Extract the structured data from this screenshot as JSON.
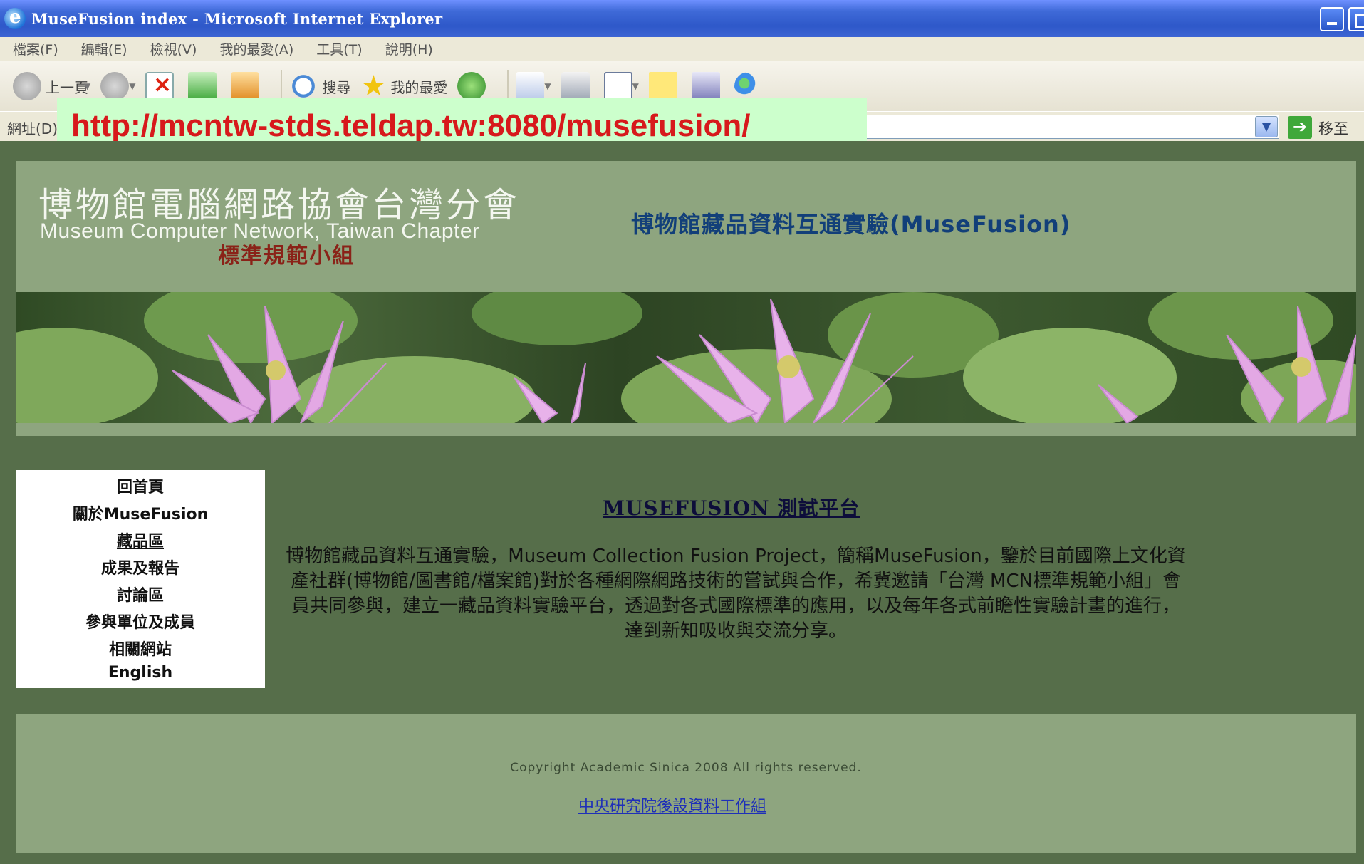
{
  "browser": {
    "window_title": "MuseFusion index - Microsoft Internet Explorer",
    "menu": [
      "檔案(F)",
      "編輯(E)",
      "檢視(V)",
      "我的最愛(A)",
      "工具(T)",
      "說明(H)"
    ],
    "toolbar": {
      "back_label": "上一頁",
      "search_label": "搜尋",
      "favorites_label": "我的最愛"
    },
    "address_label": "網址(D)",
    "go_label": "移至",
    "url_overlay": "http://mcntw-stds.teldap.tw:8080/musefusion/"
  },
  "header": {
    "logo_cn": "博物館電腦網路協會台灣分會",
    "logo_en": "Museum Computer Network, Taiwan Chapter",
    "logo_sub": "標準規範小組",
    "title": "博物館藏品資料互通實驗(MuseFusion)"
  },
  "nav": {
    "items": [
      "回首頁",
      "關於MuseFusion",
      "藏品區",
      "成果及報告",
      "討論區",
      "參與單位及成員",
      "相關網站",
      "English"
    ]
  },
  "main": {
    "title": "MUSEFUSION 測試平台",
    "intro": "博物館藏品資料互通實驗，Museum Collection Fusion Project，簡稱MuseFusion，鑒於目前國際上文化資產社群(博物館/圖書館/檔案館)對於各種網際網路技術的嘗試與合作，希冀邀請「台灣 MCN標準規範小組」會員共同參與，建立一藏品資料實驗平台，透過對各式國際標準的應用，以及每年各式前瞻性實驗計畫的進行，達到新知吸收與交流分享。"
  },
  "footer": {
    "copyright": "Copyright Academic Sinica 2008 All rights reserved.",
    "link": "中央研究院後設資料工作組"
  },
  "colors": {
    "page_bg": "#566e4a",
    "panel_bg": "#8ea57f",
    "url_overlay_bg": "#ccffcc",
    "url_overlay_text": "#d7191c",
    "title_blue": "#123f79",
    "subtitle_red": "#8a2218"
  }
}
